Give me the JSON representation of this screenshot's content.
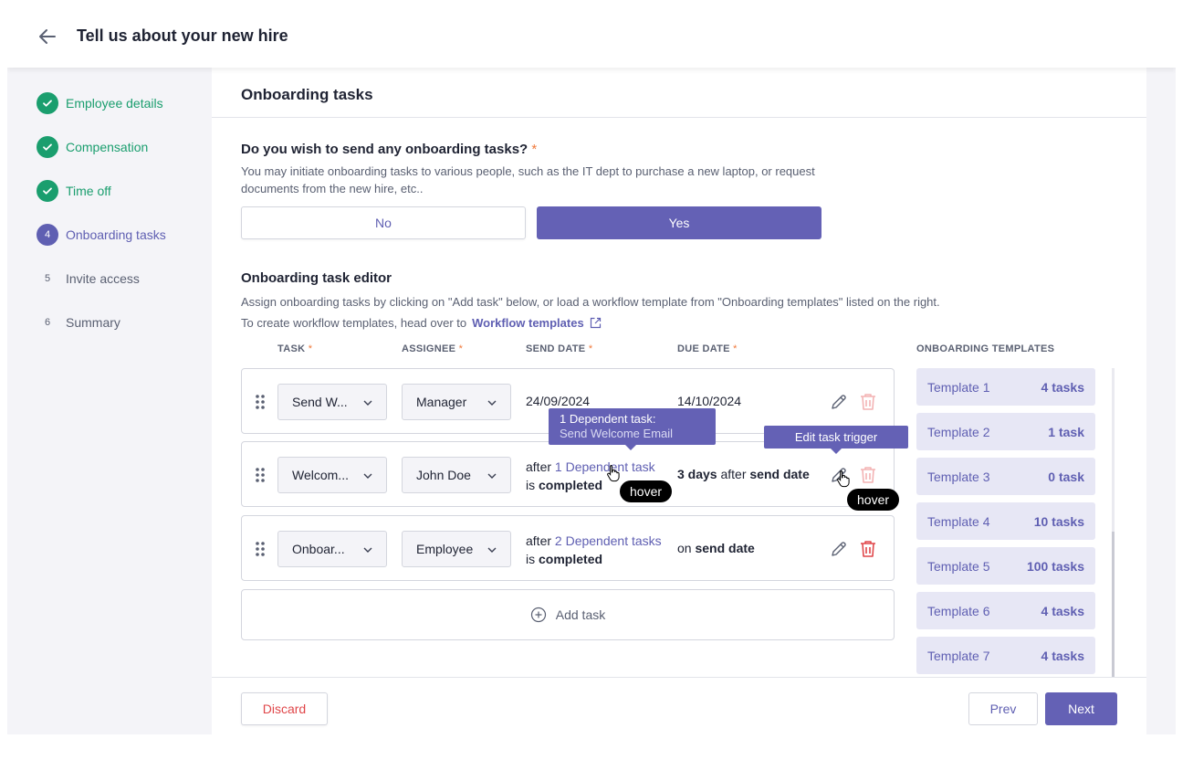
{
  "header": {
    "title": "Tell us about your new hire"
  },
  "steps": [
    {
      "label": "Employee details",
      "state": "done",
      "number": ""
    },
    {
      "label": "Compensation",
      "state": "done",
      "number": ""
    },
    {
      "label": "Time off",
      "state": "done",
      "number": ""
    },
    {
      "label": "Onboarding tasks",
      "state": "active",
      "number": "4"
    },
    {
      "label": "Invite access",
      "state": "todo",
      "number": "5"
    },
    {
      "label": "Summary",
      "state": "todo",
      "number": "6"
    }
  ],
  "panel": {
    "title": "Onboarding tasks",
    "question": {
      "title": "Do you wish to send any onboarding tasks?",
      "required_mark": "*",
      "description": "You may initiate onboarding tasks to various people, such as the IT dept to purchase a new laptop, or request documents from the new hire, etc..",
      "no_label": "No",
      "yes_label": "Yes",
      "selected": "Yes"
    },
    "editor": {
      "title": "Onboarding task editor",
      "desc1": "Assign onboarding tasks by clicking on \"Add task\" below, or load a workflow template from \"Onboarding templates\" listed on the right.",
      "desc2": "To create workflow templates, head over to",
      "workflow_link": "Workflow templates",
      "columns": {
        "task": "TASK",
        "assignee": "ASSIGNEE",
        "send_date": "SEND DATE",
        "due_date": "DUE DATE",
        "req": "*"
      },
      "rows": [
        {
          "task": "Send W...",
          "assignee": "Manager",
          "send_date": "24/09/2024",
          "due_date": "14/10/2024"
        },
        {
          "task": "Welcom...",
          "assignee": "John Doe",
          "send_prefix": "after",
          "send_link": "1 Dependent task",
          "send_mid": "is",
          "send_bold": "completed",
          "due_bold1": "3 days",
          "due_mid": "after",
          "due_bold2": "send date"
        },
        {
          "task": "Onboar...",
          "assignee": "Employee",
          "send_prefix": "after",
          "send_link": "2 Dependent tasks",
          "send_mid": "is",
          "send_bold": "completed",
          "due_prefix": "on",
          "due_bold": "send date"
        }
      ],
      "add_task": "Add task"
    },
    "templates": {
      "title": "ONBOARDING TEMPLATES",
      "items": [
        {
          "name": "Template 1",
          "count": "4 tasks"
        },
        {
          "name": "Template 2",
          "count": "1 task"
        },
        {
          "name": "Template 3",
          "count": "0 task"
        },
        {
          "name": "Template 4",
          "count": "10 tasks"
        },
        {
          "name": "Template 5",
          "count": "100 tasks"
        },
        {
          "name": "Template 6",
          "count": "4 tasks"
        },
        {
          "name": "Template 7",
          "count": "4 tasks"
        }
      ]
    },
    "footer": {
      "discard": "Discard",
      "prev": "Prev",
      "next": "Next"
    }
  },
  "overlays": {
    "dep_tooltip_title": "1 Dependent task:",
    "dep_tooltip_item": "Send Welcome Email",
    "edit_tooltip": "Edit task trigger",
    "hover_label": "hover"
  },
  "colors": {
    "accent": "#6461b5",
    "success": "#1a9e6e",
    "danger": "#e0474a",
    "required": "#f07a3c"
  }
}
